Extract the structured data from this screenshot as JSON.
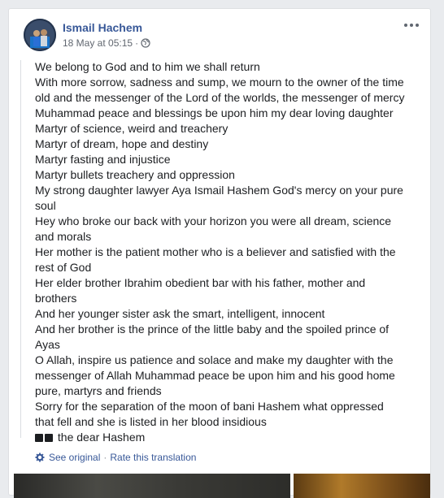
{
  "post": {
    "author": "Ismail Hachem",
    "timestamp": "18 May at 05:15",
    "separator": "·",
    "privacy_icon": "globe-icon",
    "more_icon": "more-options-icon"
  },
  "text_lines": [
    "We belong to God and to him we shall return",
    "With more sorrow, sadness and sump, we mourn to the owner of the time",
    "old and the messenger of the Lord of the worlds, the messenger of mercy",
    "Muhammad peace and blessings be upon him my dear loving daughter",
    "Martyr of science, weird and treachery",
    "Martyr of dream, hope and destiny",
    "Martyr fasting and injustice",
    "Martyr bullets treachery and oppression",
    "My strong daughter lawyer Aya Ismail Hashem God's mercy on your pure",
    "soul",
    "Hey who broke our back with your horizon you were all dream, science",
    "and morals",
    "Her mother is the patient mother who is a believer and satisfied with the",
    "rest of God",
    "Her elder brother Ibrahim obedient bar with his father, mother and",
    "brothers",
    "And her younger sister ask the smart, intelligent, innocent",
    "And her brother is the prince of the little baby and the spoiled prince of",
    "Ayas",
    "O Allah, inspire us patience and solace and make my daughter with the",
    "messenger of Allah Muhammad peace be upon him and his good home",
    "pure, martyrs and friends",
    "Sorry for the separation of the moon of bani Hashem what oppressed",
    "that fell and she is listed in her blood insidious"
  ],
  "last_line_text": "the dear Hashem",
  "translation": {
    "see_original": "See original",
    "separator": "·",
    "rate": "Rate this translation"
  },
  "colors": {
    "link": "#385898",
    "text": "#1c1e21",
    "meta": "#616770",
    "background": "#e9ebee"
  }
}
